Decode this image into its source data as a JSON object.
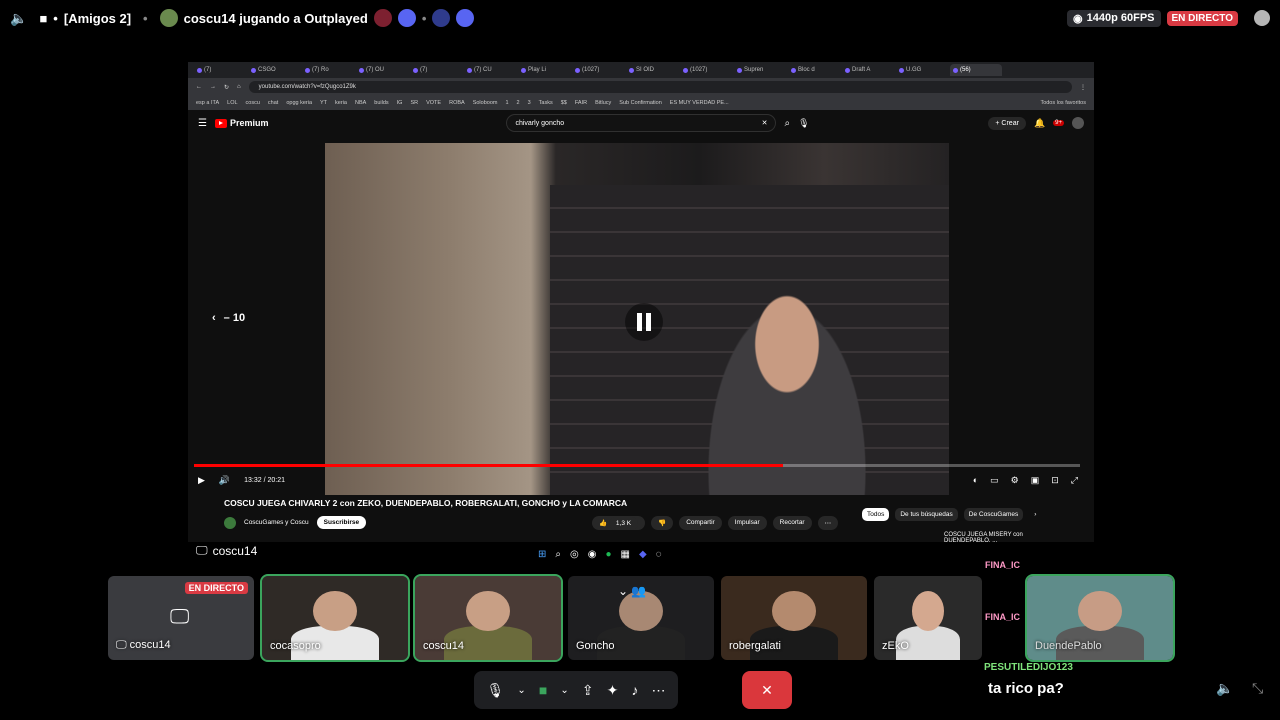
{
  "topbar": {
    "voice_state": "■",
    "channel": "[Amigos 2]",
    "activity": "coscu14 jugando a Outplayed",
    "quality": "1440p 60FPS",
    "live_badge": "EN DIRECTO"
  },
  "browser": {
    "tabs": [
      "(7)",
      "CSGO",
      "(7) Ro",
      "(7) OU",
      "(7)",
      "(7) CU",
      "Play Li",
      "(1027)",
      "SI OID",
      "(1027)",
      "Supren",
      "Bloc d",
      "Draft A",
      "U.GG",
      "(56)"
    ],
    "url": "youtube.com/watch?v=fzQugco1Z9k",
    "bookmarks": [
      "esp a ITA",
      "LOL",
      "coscu",
      "chat",
      "opgg keria",
      "YT",
      "keria",
      "NBA",
      "builds",
      "IG",
      "SR",
      "VOTE",
      "ROBA",
      "Soloboom",
      "1",
      "2",
      "3",
      "Tasks",
      "$$",
      "FAIR",
      "Bitlucy",
      "Sub Confirmation",
      "ES MUY VERDAD PE..."
    ],
    "bookmarks_all": "Todos los favoritos"
  },
  "youtube": {
    "logo": "Premium",
    "search_query": "chivarly goncho",
    "create": "+ Crear",
    "notif_count": "9+",
    "skip_label": "– 10",
    "time": "13:32 / 20:21",
    "progress": 0.665,
    "title": "COSCU JUEGA CHIVARLY 2 con ZEKO, DUENDEPABLO, ROBERGALATI, GONCHO y LA COMARCA",
    "channel": "CoscuGames y Coscu",
    "subscribe": "Suscribirse",
    "likes": "1,3 K",
    "share": "Compartir",
    "promote": "Impulsar",
    "clip": "Recortar",
    "chips": [
      "Todos",
      "De tus búsquedas",
      "De CoscuGames"
    ],
    "side_title": "COSCU JUEGA MISERY con DUENDEPABLO, ..."
  },
  "stream_label": "coscu14",
  "participants": [
    {
      "name": "coscu14",
      "live": "EN DIRECTO",
      "screen": true,
      "speaking": false
    },
    {
      "name": "cocasopro",
      "speaking": true
    },
    {
      "name": "coscu14",
      "speaking": true
    },
    {
      "name": "Goncho",
      "speaking": false
    },
    {
      "name": "robergalati",
      "speaking": false
    },
    {
      "name": "zEkO",
      "speaking": false
    },
    {
      "name": "DuendePablo",
      "speaking": true
    }
  ],
  "chat": {
    "mini_user_1": "FINA_IC",
    "mini_user_2": "FINA_IC",
    "user": "PESUTILEDIJO123",
    "message": "ta rico pa?"
  },
  "colors": {
    "live": "#d93a43",
    "speaking": "#3ba55d",
    "endcall": "#da373c",
    "yt_red": "#ff0000"
  }
}
